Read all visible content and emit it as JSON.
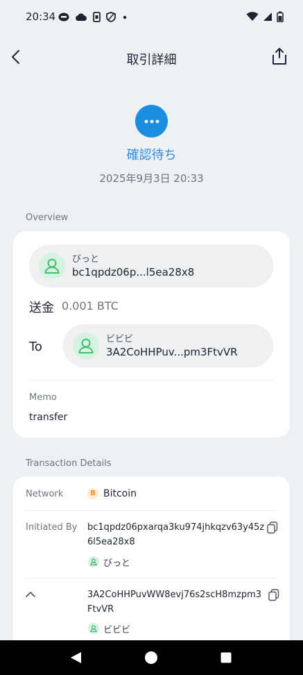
{
  "status_bar": {
    "time": "20:34",
    "icons_left": [
      "line-icon",
      "cloud-icon",
      "sim-icon",
      "shield-icon",
      "dot-icon"
    ],
    "icons_right": [
      "wifi-icon",
      "signal-icon",
      "battery-icon"
    ]
  },
  "header": {
    "title": "取引詳細"
  },
  "status": {
    "text": "確認待ち",
    "date": "2025年9月3日 20:33",
    "color": "#1a8fe0"
  },
  "overview": {
    "label": "Overview",
    "from": {
      "name": "びっと",
      "address": "bc1qpdz06p...l5ea28x8"
    },
    "send_label": "送金",
    "amount": "0.001 BTC",
    "to_label": "To",
    "to": {
      "name": "ビビビ",
      "address": "3A2CoHHPuv...pm3FtvVR"
    },
    "memo_label": "Memo",
    "memo": "transfer"
  },
  "details": {
    "label": "Transaction Details",
    "network_label": "Network",
    "network": "Bitcoin",
    "network_badge": "B",
    "initiated_label": "Initiated By",
    "initiated_addr_line1": "bc1qpdz06pxarqa3ku974jhkqzv63y45z",
    "initiated_addr_line2": "6l5ea28x8",
    "initiated_name": "びっと",
    "to_addr_line1": "3A2CoHHPuvWW8evj76s2scH8mzpm3",
    "to_addr_line2": "FtvVR",
    "to_name": "ビビビ"
  },
  "colors": {
    "accent": "#1a8fe0",
    "avatar_green": "#3fbf6f",
    "bitcoin": "#f7931a"
  }
}
